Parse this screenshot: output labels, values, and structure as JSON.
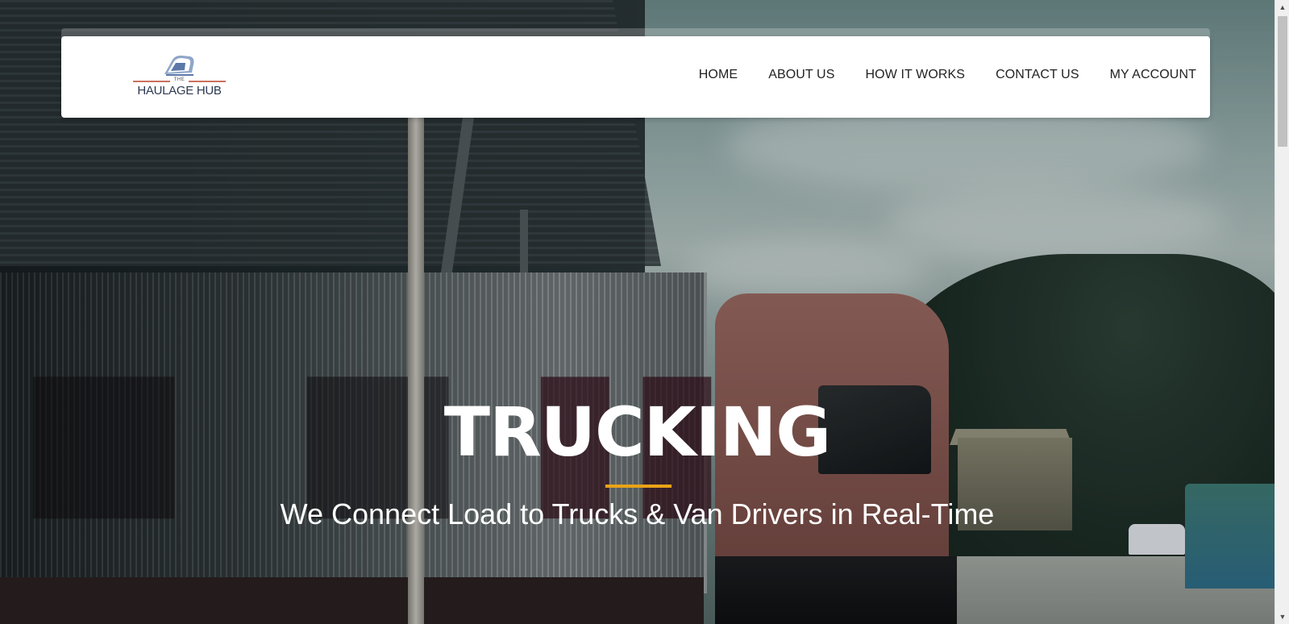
{
  "brand": {
    "logo_the": "THE",
    "logo_name": "HAULAGE HUB"
  },
  "nav": {
    "items": [
      {
        "label": "HOME"
      },
      {
        "label": "ABOUT US"
      },
      {
        "label": "HOW IT WORKS"
      },
      {
        "label": "CONTACT US"
      },
      {
        "label": "MY ACCOUNT"
      }
    ]
  },
  "hero": {
    "title": "TRUCKING",
    "subtitle": "We Connect Load to Trucks & Van Drivers in Real-Time",
    "accent_color": "#e8a317"
  },
  "icons": {
    "logo": "truck-logo-icon",
    "scroll_up": "chevron-up-icon",
    "scroll_down": "chevron-down-icon"
  }
}
